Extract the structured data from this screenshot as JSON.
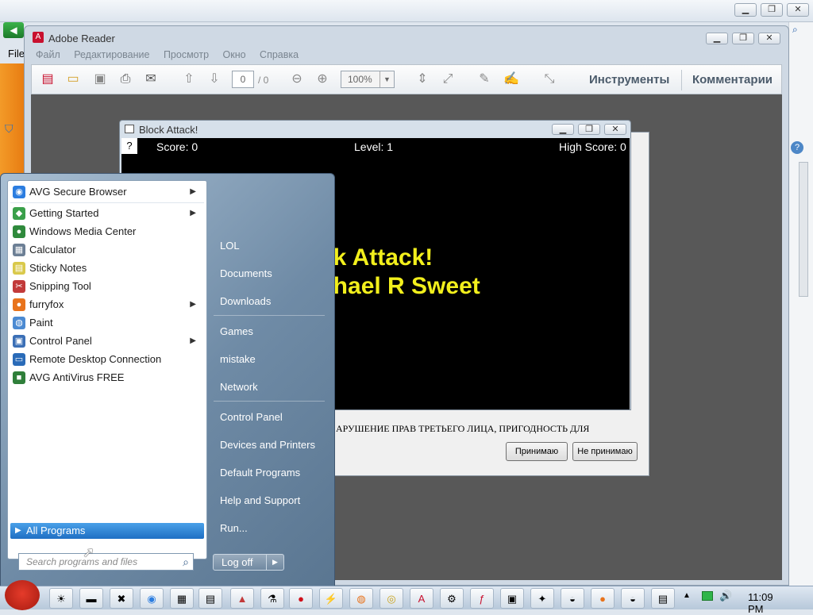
{
  "back_window": {
    "menu_label": "File"
  },
  "reader": {
    "title": "Adobe Reader",
    "menu": [
      "Файл",
      "Редактирование",
      "Просмотр",
      "Окно",
      "Справка"
    ],
    "page_current": "0",
    "page_total": "/ 0",
    "zoom": "100%",
    "tools_label": "Инструменты",
    "comments_label": "Комментарии"
  },
  "block_attack": {
    "title": "Block Attack!",
    "help": "?",
    "score": "Score: 0",
    "level": "Level: 1",
    "high_score": "High Score: 0",
    "banner_line1": "ck Attack!",
    "banner_line2": "chael R Sweet"
  },
  "license_dialog": {
    "text": "АРУШЕНИЕ ПРАВ ТРЕТЬЕГО ЛИЦА, ПРИГОДНОСТЬ ДЛЯ",
    "accept": "Принимаю",
    "decline": "Не принимаю"
  },
  "start_menu": {
    "programs": [
      {
        "label": "AVG Secure Browser",
        "submenu": true,
        "color": "#2b7de0"
      },
      {
        "label": "Getting Started",
        "submenu": true,
        "color": "#3aa04a"
      },
      {
        "label": "Windows Media Center",
        "submenu": false,
        "color": "#2f8a3c"
      },
      {
        "label": "Calculator",
        "submenu": false,
        "color": "#6c7f95"
      },
      {
        "label": "Sticky Notes",
        "submenu": false,
        "color": "#d9c94b"
      },
      {
        "label": "Snipping Tool",
        "submenu": false,
        "color": "#c23a3a"
      },
      {
        "label": "furryfox",
        "submenu": true,
        "color": "#e8731c"
      },
      {
        "label": "Paint",
        "submenu": false,
        "color": "#4b8ad2"
      },
      {
        "label": "Control Panel",
        "submenu": true,
        "color": "#3b6fb6"
      },
      {
        "label": "Remote Desktop Connection",
        "submenu": false,
        "color": "#2a6bb8"
      },
      {
        "label": "AVG AntiVirus FREE",
        "submenu": false,
        "color": "#2f7f3a"
      }
    ],
    "all_programs": "All Programs",
    "search_placeholder": "Search programs and files",
    "right_items": [
      "LOL",
      "Documents",
      "Downloads",
      "Games",
      "mistake",
      "Network",
      "Control Panel",
      "Devices and Printers",
      "Default Programs",
      "Help and Support",
      "Run..."
    ],
    "logoff": "Log off"
  },
  "taskbar": {
    "clock": "11:09 PM"
  }
}
